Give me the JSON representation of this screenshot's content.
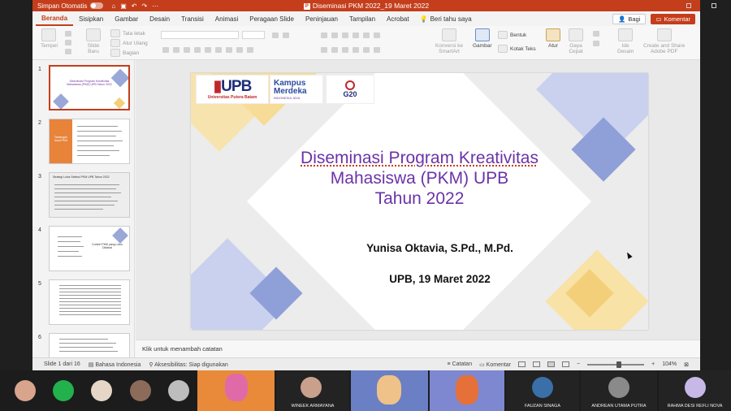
{
  "titlebar": {
    "autosave_label": "Simpan Otomatis",
    "doc_title": "Diseminasi PKM 2022_19 Maret 2022",
    "app_letter": "P"
  },
  "tabs": [
    "Beranda",
    "Sisipkan",
    "Gambar",
    "Desain",
    "Transisi",
    "Animasi",
    "Peragaan Slide",
    "Peninjauan",
    "Tampilan",
    "Acrobat"
  ],
  "active_tab": "Beranda",
  "tell_me": "Beri tahu saya",
  "share_label": "Bagi",
  "comments_label": "Komentar",
  "ribbon": {
    "paste": "Tempel",
    "new_slide": "Slide\nBaru",
    "layout": "Tata letak",
    "reset": "Atur Ulang",
    "section": "Bagian",
    "convert_smartart": "Konversi ke\nSmartArt",
    "picture": "Gambar",
    "shape": "Bentuk",
    "textbox": "Kotak Teks",
    "arrange": "Atur",
    "quick_styles": "Gaya\nCepat",
    "design_ideas": "Ide\nDesain",
    "create_share_pdf": "Create and Share\nAdobe PDF"
  },
  "thumbnails": {
    "numbers": [
      "1",
      "2",
      "3",
      "4",
      "5",
      "6"
    ],
    "slide1_text": "Diseminasi Program Kreativitas Mahasiswa (PKM) UPB Tahun 2022",
    "slide2_text": "Tantangan Awal PKM",
    "slide3_text": "Strategi Lolos Seleksi PKM UPB Tahun 2022",
    "slide4_text": "Contoh PKM yang Lolos Didanai"
  },
  "slide": {
    "logo_upb": "UPB",
    "logo_upb_sub": "Universitas Putera Batam",
    "logo_km_1": "Kampus",
    "logo_km_2": "Merdeka",
    "logo_km_3": "INDONESIA JAYA",
    "logo_g20": "G20",
    "title_line1": "Diseminasi Program Kreativitas",
    "title_line2": "Mahasiswa (PKM) UPB",
    "title_line3": "Tahun 2022",
    "author": "Yunisa Oktavia, S.Pd., M.Pd.",
    "date_line": "UPB, 19 Maret 2022"
  },
  "notes_placeholder": "Klik untuk menambah catatan",
  "status": {
    "slide_pos": "Slide 1 dari 16",
    "language": "Bahasa Indonesia",
    "accessibility": "Aksesibilitas: Siap digunakan",
    "notes": "Catatan",
    "comments": "Komentar",
    "zoom": "104%"
  },
  "participants": [
    "WINEEK ARMAYANA",
    "FAUZAN SINAGA",
    "ANDREAN UTAMA PUTRA",
    "RAHMA DESI REFLI NOVA"
  ],
  "colors": {
    "accent": "#c43e1c",
    "title_purple": "#6a33a8",
    "slide_yellow": "#f5d58a",
    "slide_blue": "#8f9fd8"
  }
}
